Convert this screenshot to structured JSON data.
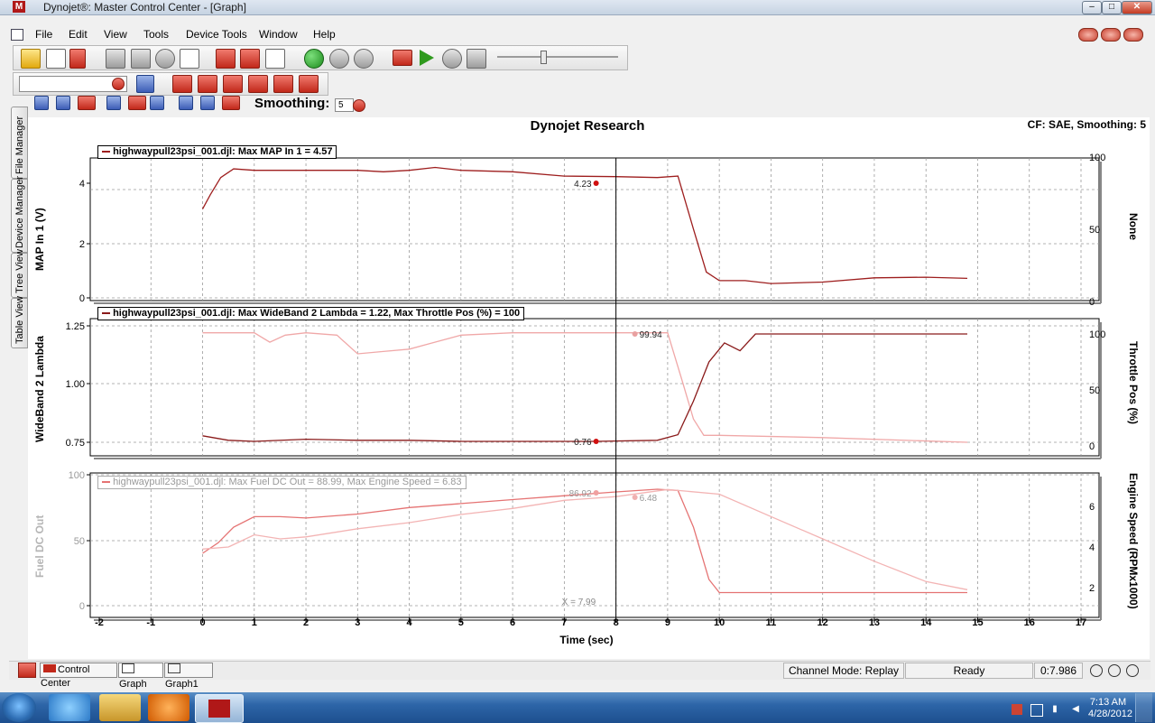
{
  "window": {
    "title": "Dynojet®: Master Control Center - [Graph]",
    "logo": "M",
    "buttons": [
      "–",
      "□",
      "✕"
    ]
  },
  "menu": [
    "File",
    "Edit",
    "View",
    "Tools",
    "Device Tools",
    "Window",
    "Help"
  ],
  "mdi_buttons": [
    "minimize",
    "restore",
    "close"
  ],
  "smoothing": {
    "label": "Smoothing:",
    "value": "5"
  },
  "side_tabs": [
    "File Manager",
    "Device Manager",
    "Tree View",
    "Table View"
  ],
  "graph": {
    "title": "Dynojet Research",
    "info": "CF: SAE, Smoothing: 5",
    "x_label": "Time (sec)",
    "x_ticks": [
      "-2",
      "-1",
      "0",
      "1",
      "2",
      "3",
      "4",
      "5",
      "6",
      "7",
      "8",
      "9",
      "10",
      "11",
      "12",
      "13",
      "14",
      "15",
      "16",
      "17"
    ],
    "cursor": {
      "label": "X = 7.99"
    },
    "panels": [
      {
        "legend": "highwaypull23psi_001.djl: Max MAP In 1 = 4.57",
        "left_label": "MAP In 1 (V)",
        "right_label": "None",
        "left_ticks": [
          "4",
          "2",
          "0"
        ],
        "right_ticks": [
          "100",
          "50",
          "0"
        ],
        "markers": [
          "4.23"
        ]
      },
      {
        "legend": "highwaypull23psi_001.djl: Max WideBand 2 Lambda = 1.22, Max Throttle Pos (%) = 100",
        "left_label": "WideBand 2 Lambda",
        "right_label": "Throttle Pos (%)",
        "left_ticks": [
          "1.25",
          "1.00",
          "0.75"
        ],
        "right_ticks": [
          "100",
          "50",
          "0"
        ],
        "markers": [
          "99.94",
          "0.76"
        ]
      },
      {
        "legend": "highwaypull23psi_001.djl: Max Fuel DC Out = 88.99, Max Engine Speed = 6.83",
        "left_label": "Fuel DC Out",
        "right_label": "Engine Speed (RPMx1000)",
        "left_ticks": [
          "100",
          "50",
          "0"
        ],
        "right_ticks": [
          "6",
          "4",
          "2"
        ],
        "markers": [
          "86.92",
          "6.48"
        ]
      }
    ]
  },
  "chart_data": [
    {
      "type": "line",
      "title": "Dynojet Research",
      "xlabel": "Time (sec)",
      "xlim": [
        -2,
        17
      ],
      "ylim": [
        0,
        5
      ],
      "y2lim": [
        0,
        100
      ],
      "ylabel": "MAP In 1 (V)",
      "y2label": "None",
      "series": [
        {
          "name": "MAP In 1",
          "axis": "left",
          "color": "#9e1e1e",
          "x": [
            0,
            0.15,
            0.35,
            0.6,
            1.0,
            2.0,
            3.0,
            3.5,
            4.0,
            4.5,
            5.0,
            6.0,
            7.0,
            8.0,
            8.8,
            9.2,
            9.5,
            9.75,
            10.0,
            10.5,
            11.0,
            12.0,
            13.0,
            14.0,
            14.8
          ],
          "y": [
            3.1,
            3.6,
            4.2,
            4.5,
            4.45,
            4.45,
            4.45,
            4.4,
            4.45,
            4.55,
            4.45,
            4.4,
            4.25,
            4.23,
            4.2,
            4.25,
            2.4,
            0.9,
            0.6,
            0.6,
            0.5,
            0.55,
            0.7,
            0.72,
            0.68
          ]
        }
      ]
    },
    {
      "type": "line",
      "xlabel": "Time (sec)",
      "xlim": [
        -2,
        17
      ],
      "ylim": [
        0.7,
        1.27
      ],
      "y2lim": [
        0,
        100
      ],
      "ylabel": "WideBand 2 Lambda",
      "y2label": "Throttle Pos (%)",
      "series": [
        {
          "name": "WideBand 2 Lambda",
          "axis": "left",
          "color": "#f0a8a8",
          "x": [
            0,
            1.0,
            1.3,
            1.6,
            2.0,
            2.6,
            3.0,
            3.5,
            4.0,
            5.0,
            6.0,
            8.0,
            9.0,
            9.3,
            9.5,
            9.7,
            10.0,
            12.0,
            14.8
          ],
          "y": [
            1.22,
            1.22,
            1.18,
            1.21,
            1.22,
            1.21,
            1.13,
            1.14,
            1.15,
            1.21,
            1.22,
            1.22,
            1.22,
            1.0,
            0.85,
            0.78,
            0.78,
            0.77,
            0.75
          ]
        },
        {
          "name": "Throttle Pos (%)",
          "axis": "right",
          "color": "#8a1a1a",
          "x": [
            0,
            0.5,
            1.0,
            2.0,
            3.0,
            4.0,
            5.0,
            6.0,
            7.6,
            8.8,
            9.2,
            9.5,
            9.8,
            10.1,
            10.4,
            10.7,
            12.0,
            14.8
          ],
          "y": [
            9,
            5,
            4,
            6,
            5,
            5,
            4,
            4,
            4,
            5,
            10,
            40,
            75,
            92,
            85,
            100,
            100,
            100
          ]
        }
      ]
    },
    {
      "type": "line",
      "xlabel": "Time (sec)",
      "xlim": [
        -2,
        17
      ],
      "ylim": [
        -5,
        100
      ],
      "y2lim": [
        1,
        7.5
      ],
      "ylabel": "Fuel DC Out",
      "y2label": "Engine Speed (RPMx1000)",
      "series": [
        {
          "name": "Fuel DC Out",
          "axis": "left",
          "color": "#e57373",
          "x": [
            0,
            0.3,
            0.6,
            1.0,
            1.5,
            2.0,
            3.0,
            4.0,
            5.0,
            6.0,
            7.0,
            8.0,
            8.8,
            9.2,
            9.5,
            9.8,
            10.0,
            11.0,
            12.0,
            14.8
          ],
          "y": [
            40,
            48,
            60,
            68,
            68,
            67,
            70,
            75,
            78,
            81,
            84,
            86.92,
            88.99,
            88,
            60,
            20,
            10,
            10,
            10,
            10
          ]
        },
        {
          "name": "Engine Speed",
          "axis": "right",
          "color": "#f3b4b4",
          "x": [
            0,
            0.5,
            1.0,
            1.5,
            2.0,
            3.0,
            4.0,
            5.0,
            6.0,
            7.0,
            8.0,
            9.0,
            10.0,
            11.0,
            12.0,
            13.0,
            14.0,
            14.8
          ],
          "y": [
            3.9,
            4.0,
            4.6,
            4.4,
            4.5,
            4.9,
            5.2,
            5.6,
            5.9,
            6.3,
            6.48,
            6.83,
            6.6,
            5.5,
            4.4,
            3.3,
            2.3,
            1.9
          ]
        }
      ]
    }
  ],
  "doc_tabs": [
    "Control Center",
    "Graph",
    "Graph1"
  ],
  "status": {
    "channel_mode": "Channel Mode: Replay",
    "state": "Ready",
    "time": "0:7.986",
    "led_colors": [
      "#1f8a1f",
      "#8a8a1a",
      "#7a1010"
    ]
  },
  "taskbar": {
    "time": "7:13 AM",
    "date": "4/28/2012"
  }
}
